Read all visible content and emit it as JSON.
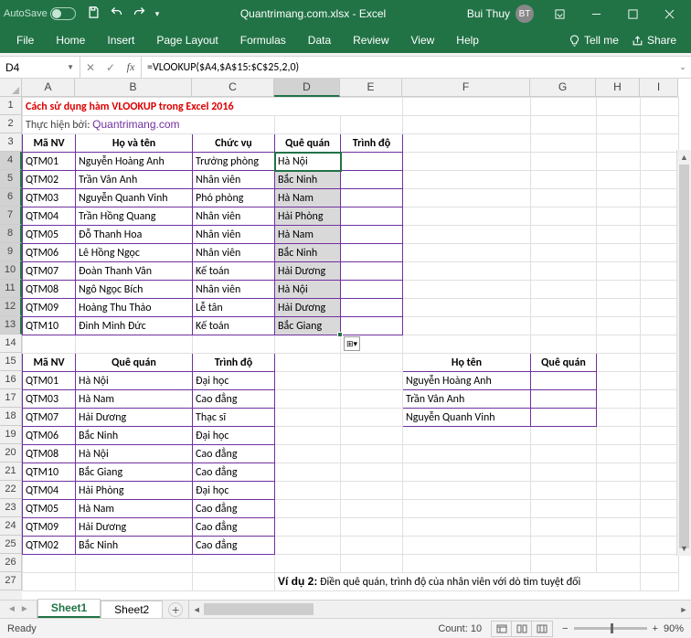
{
  "titlebar": {
    "autosave": "AutoSave",
    "filename": "Quantrimang.com.xlsx  -  Excel",
    "username": "Bui Thuy"
  },
  "ribbon": {
    "tabs": [
      "File",
      "Home",
      "Insert",
      "Page Layout",
      "Formulas",
      "Data",
      "Review",
      "View",
      "Help"
    ],
    "tellme": "Tell me",
    "share": "Share"
  },
  "namebox": "D4",
  "formula": "=VLOOKUP($A4,$A$15:$C$25,2,0)",
  "cols": {
    "A": 58,
    "B": 128,
    "C": 90,
    "D": 72,
    "E": 68,
    "F": 140,
    "G": 72,
    "H": 48,
    "I": 42
  },
  "row_count": 27,
  "selected_rows_start": 4,
  "selected_rows_end": 13,
  "selected_col": "D",
  "title_text": "Cách sử dụng hàm VLOOKUP trong Excel 2016",
  "subtitle_prefix": "Thực hiện bởi: ",
  "subtitle_link": "Quantrimang.com",
  "table1": {
    "headers": [
      "Mã NV",
      "Họ và tên",
      "Chức vụ",
      "Quê quán",
      "Trình độ"
    ],
    "rows": [
      [
        "QTM01",
        "Nguyễn Hoàng Anh",
        "Trưởng phòng",
        "Hà Nội",
        ""
      ],
      [
        "QTM02",
        "Trần Vân Anh",
        "Nhân viên",
        "Bắc Ninh",
        ""
      ],
      [
        "QTM03",
        "Nguyễn Quanh Vinh",
        "Phó phòng",
        "Hà Nam",
        ""
      ],
      [
        "QTM04",
        "Trần Hồng Quang",
        "Nhân viên",
        "Hải Phòng",
        ""
      ],
      [
        "QTM05",
        "Đỗ Thanh Hoa",
        "Nhân viên",
        "Hà Nam",
        ""
      ],
      [
        "QTM06",
        "Lê Hồng Ngọc",
        "Nhân viên",
        "Bắc Ninh",
        ""
      ],
      [
        "QTM07",
        "Đoàn Thanh Vân",
        "Kế toán",
        "Hải Dương",
        ""
      ],
      [
        "QTM08",
        "Ngô Ngọc Bích",
        "Nhân viên",
        "Hà Nội",
        ""
      ],
      [
        "QTM09",
        "Hoàng Thu Thảo",
        "Lễ tân",
        "Hải Dương",
        ""
      ],
      [
        "QTM10",
        "Đinh Minh Đức",
        "Kế toán",
        "Bắc Giang",
        ""
      ]
    ]
  },
  "table2": {
    "headers": [
      "Mã NV",
      "Quê quán",
      "Trình độ"
    ],
    "rows": [
      [
        "QTM01",
        "Hà Nội",
        "Đại học"
      ],
      [
        "QTM03",
        "Hà Nam",
        "Cao đẳng"
      ],
      [
        "QTM07",
        "Hải Dương",
        "Thạc sĩ"
      ],
      [
        "QTM06",
        "Bắc Ninh",
        "Đại học"
      ],
      [
        "QTM08",
        "Hà Nội",
        "Cao đẳng"
      ],
      [
        "QTM10",
        "Bắc Giang",
        "Cao đẳng"
      ],
      [
        "QTM04",
        "Hải Phòng",
        "Đại học"
      ],
      [
        "QTM05",
        "Hà Nam",
        "Cao đẳng"
      ],
      [
        "QTM09",
        "Hải Dương",
        "Cao đẳng"
      ],
      [
        "QTM02",
        "Bắc Ninh",
        "Cao đẳng"
      ]
    ]
  },
  "table3": {
    "headers": [
      "Họ tên",
      "Quê quán"
    ],
    "rows": [
      [
        "Nguyễn Hoàng Anh",
        ""
      ],
      [
        "Trần Vân Anh",
        ""
      ],
      [
        "Nguyễn Quanh Vinh",
        ""
      ]
    ]
  },
  "note2_label": "Ví dụ 2:",
  "note2_text": " Điền quê quán, trình độ của nhân viên với dò tìm tuyệt đối",
  "sheets": [
    "Sheet1",
    "Sheet2"
  ],
  "active_sheet": 0,
  "status": {
    "ready": "Ready",
    "count_label": "Count:",
    "count": "10",
    "zoom": "90%"
  }
}
